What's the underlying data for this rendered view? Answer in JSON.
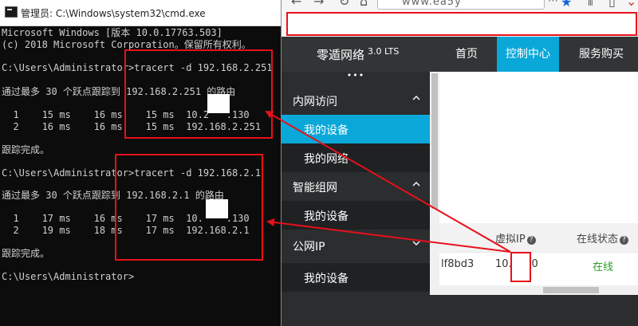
{
  "cmd": {
    "title": "管理员: C:\\Windows\\system32\\cmd.exe",
    "lines": [
      "Microsoft Windows [版本 10.0.17763.503]",
      "(c) 2018 Microsoft Corporation。保留所有权利。",
      "C:\\Users\\Administrator>tracert -d 192.168.2.251",
      "通过最多 30 个跃点跟踪到 192.168.2.251 的路由",
      "  1    15 ms    16 ms    15 ms  10.2   .130",
      "  2    16 ms    16 ms    15 ms  192.168.2.251",
      "跟踪完成。",
      "C:\\Users\\Administrator>tracert -d 192.168.2.1",
      "通过最多 30 个跃点跟踪到 192.168.2.1 的路由",
      "  1    17 ms    16 ms    17 ms  10.    .130",
      "  2    19 ms    18 ms    17 ms  192.168.2.1",
      "跟踪完成。",
      "C:\\Users\\Administrator>"
    ]
  },
  "browser": {
    "url_text": "www.ea5y",
    "brand": "零遁网络",
    "brand_version": "3.0 LTS",
    "nav": [
      "首页",
      "控制中心",
      "服务购买"
    ],
    "more": "•••",
    "sidebar": {
      "group1": "内网访问",
      "group1_item1": "我的设备",
      "group1_item2": "我的网络",
      "group2": "智能组网",
      "group2_item1": "我的设备",
      "group3": "公网IP",
      "group3_item1": "我的设备"
    },
    "table": {
      "col_ip": "虚拟IP",
      "col_status": "在线状态",
      "q": "?",
      "row_id": "lf8bd3",
      "row_ip": "10.    .130",
      "row_status": "在线"
    },
    "colors": {
      "accent": "#0aa8d8",
      "nav_bg": "#323436",
      "online": "#2e9d2e",
      "highlight": "#e8101a"
    }
  },
  "icons": [
    "cmd-icon",
    "back-arrow-icon",
    "forward-arrow-icon",
    "reload-icon",
    "home-icon",
    "star-icon",
    "library-icon",
    "sidebar-icon",
    "chevron-up-icon",
    "chevron-down-icon",
    "question-icon"
  ]
}
